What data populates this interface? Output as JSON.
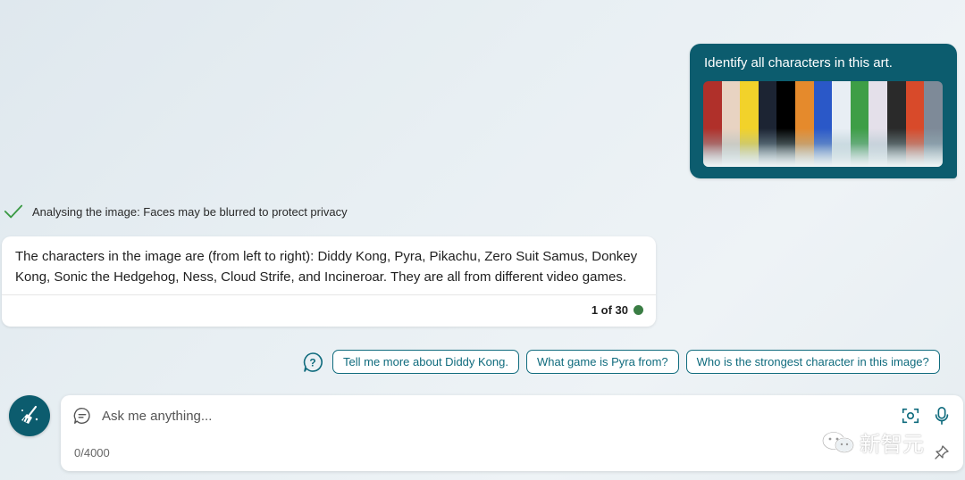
{
  "user_message": {
    "text": "Identify all characters in this art.",
    "image_strips": [
      "#b0302a",
      "#e8d3c2",
      "#f2d22a",
      "#1c2433",
      "#000000",
      "#e58a2c",
      "#2a58c8",
      "#e8eef4",
      "#3e9e46",
      "#e4e0ea",
      "#2a2a2a",
      "#d84a2a",
      "#7e8a98"
    ]
  },
  "status": {
    "icon": "check-icon",
    "text": "Analysing the image: Faces may be blurred to protect privacy"
  },
  "response": {
    "text": "The characters in the image are (from left to right): Diddy Kong, Pyra, Pikachu, Zero Suit Samus, Donkey Kong, Sonic the Hedgehog, Ness, Cloud Strife, and Incineroar. They are all from different video games.",
    "counter": "1 of 30"
  },
  "suggestions": [
    "Tell me more about Diddy Kong.",
    "What game is Pyra from?",
    "Who is the strongest character in this image?"
  ],
  "input": {
    "placeholder": "Ask me anything...",
    "char_count": "0/4000"
  },
  "watermark": {
    "text": "新智元"
  },
  "colors": {
    "accent": "#0c5c6e",
    "chip_border": "#0f6b7d",
    "status_check": "#3a9a44",
    "counter_dot": "#3a7d44"
  }
}
